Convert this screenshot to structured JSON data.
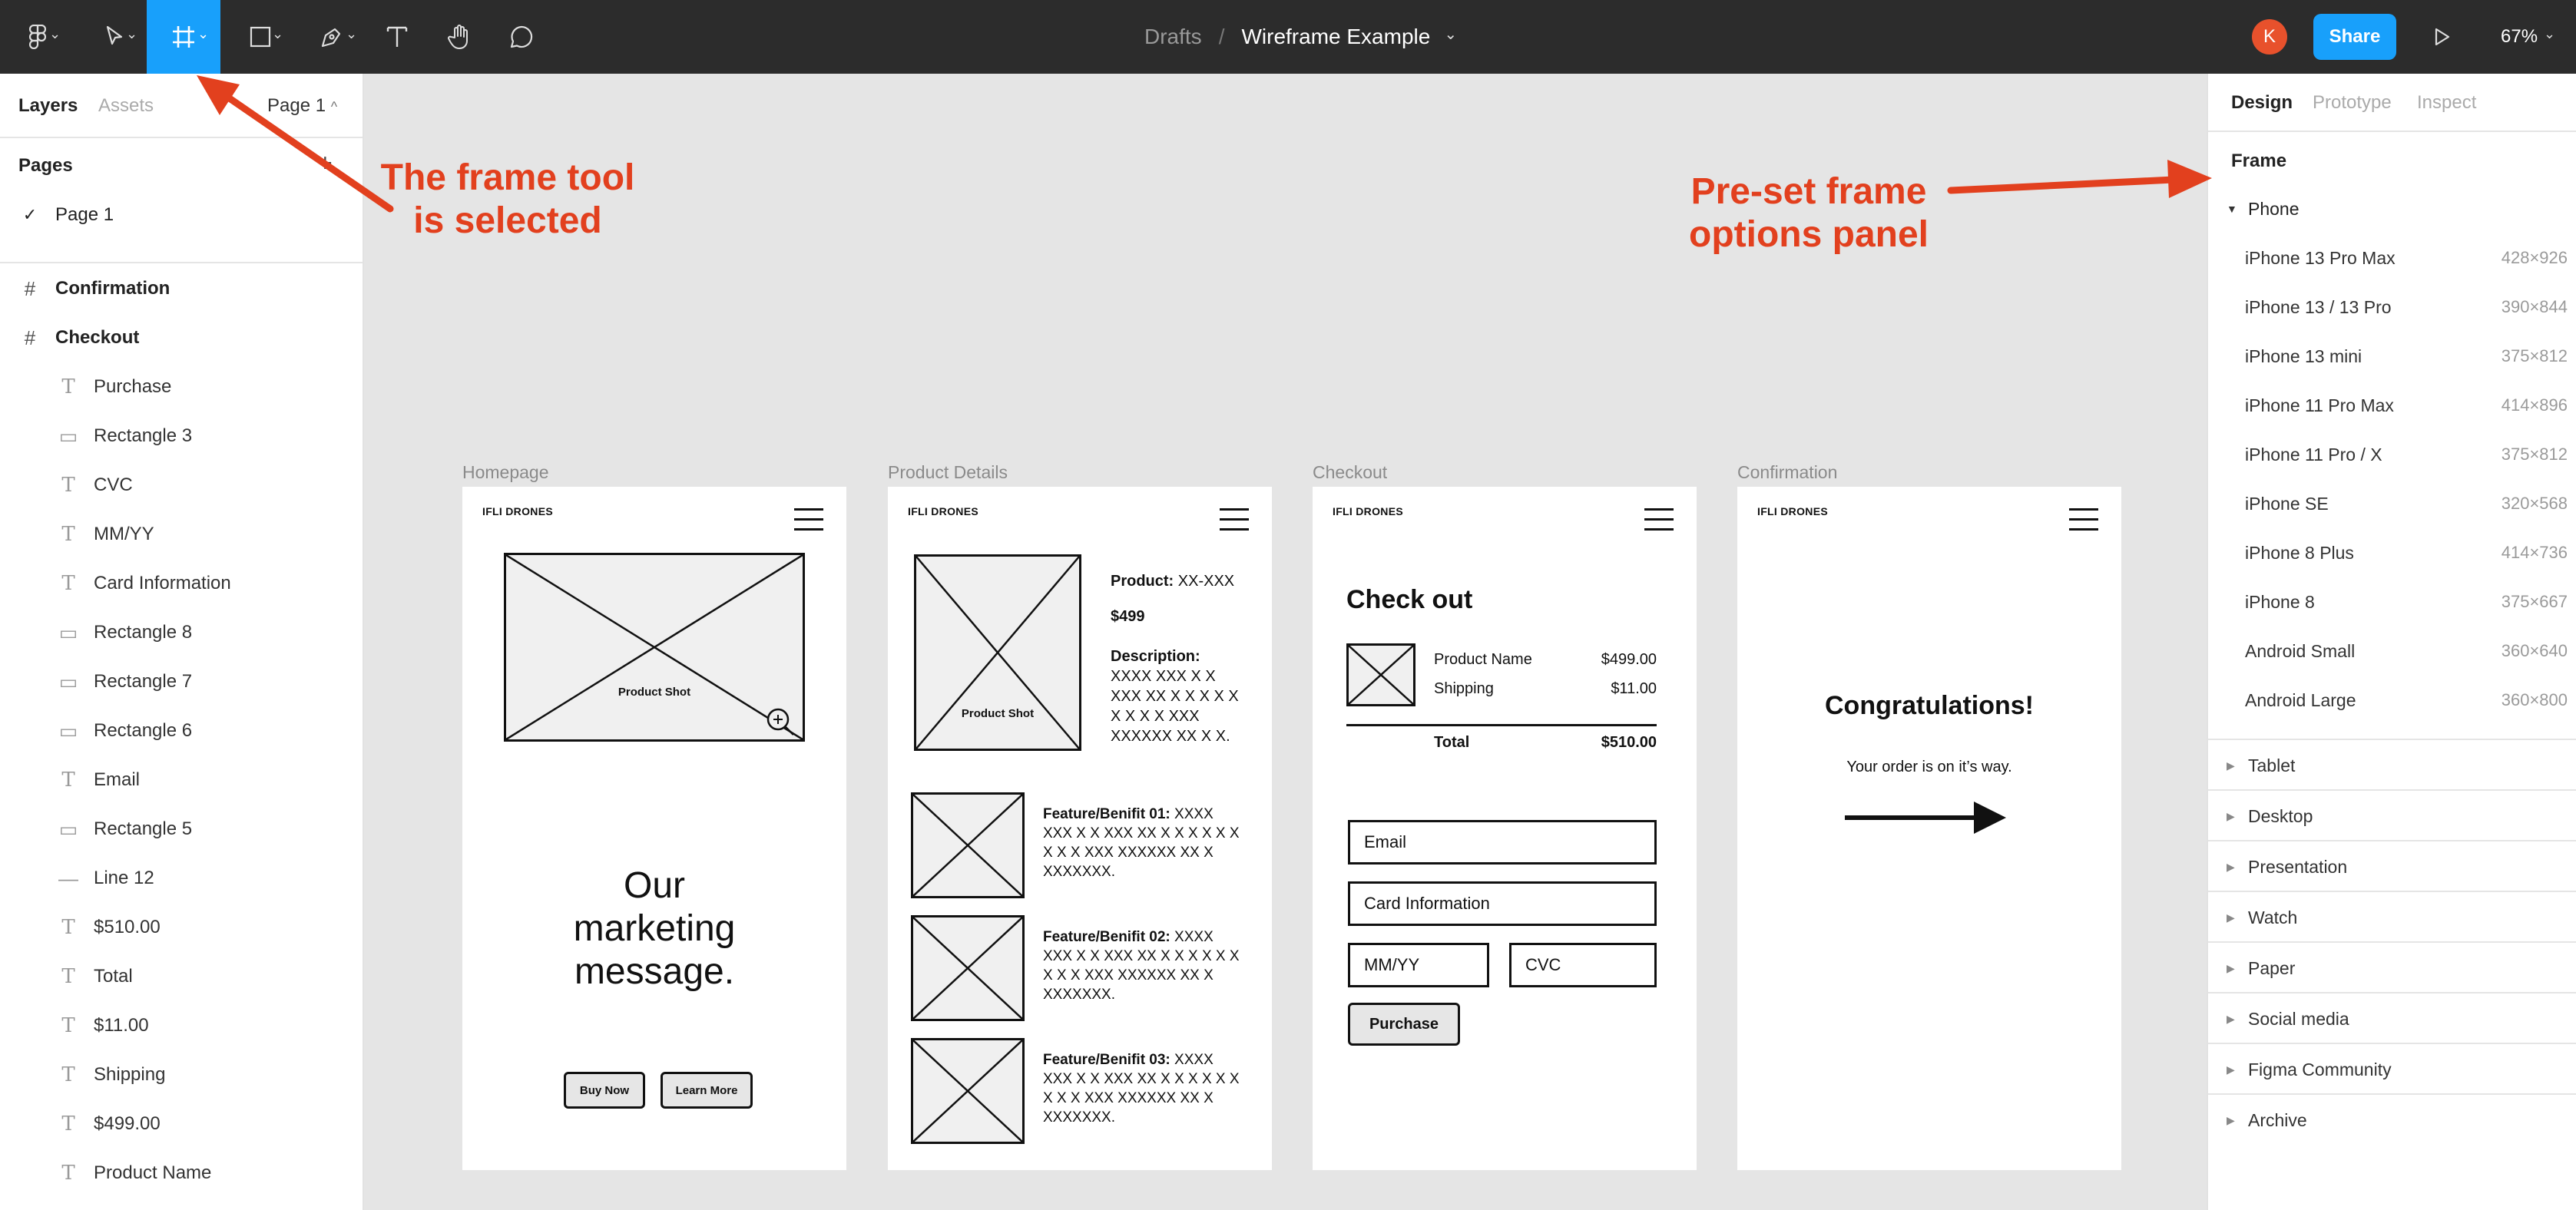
{
  "toolbar": {
    "breadcrumb_parent": "Drafts",
    "separator": "/",
    "file_name": "Wireframe Example",
    "avatar_initial": "K",
    "share_label": "Share",
    "zoom": "67%"
  },
  "left_panel": {
    "tabs": [
      "Layers",
      "Assets"
    ],
    "page_selector": "Page 1",
    "pages_heading": "Pages",
    "pages": [
      "Page 1"
    ],
    "frames": [
      "Confirmation",
      "Checkout"
    ],
    "layers": [
      {
        "name": "Purchase",
        "icon": "text-icon"
      },
      {
        "name": "Rectangle 3",
        "icon": "rectangle-icon"
      },
      {
        "name": "CVC",
        "icon": "text-icon"
      },
      {
        "name": "MM/YY",
        "icon": "text-icon"
      },
      {
        "name": "Card Information",
        "icon": "text-icon"
      },
      {
        "name": "Rectangle 8",
        "icon": "rectangle-icon"
      },
      {
        "name": "Rectangle 7",
        "icon": "rectangle-icon"
      },
      {
        "name": "Rectangle 6",
        "icon": "rectangle-icon"
      },
      {
        "name": "Email",
        "icon": "text-icon"
      },
      {
        "name": "Rectangle 5",
        "icon": "rectangle-icon"
      },
      {
        "name": "Line 12",
        "icon": "line-icon"
      },
      {
        "name": "$510.00",
        "icon": "text-icon"
      },
      {
        "name": "Total",
        "icon": "text-icon"
      },
      {
        "name": "$11.00",
        "icon": "text-icon"
      },
      {
        "name": "Shipping",
        "icon": "text-icon"
      },
      {
        "name": "$499.00",
        "icon": "text-icon"
      },
      {
        "name": "Product Name",
        "icon": "text-icon"
      }
    ]
  },
  "right_panel": {
    "tabs": [
      "Design",
      "Prototype",
      "Inspect"
    ],
    "section": "Frame",
    "open_category": "Phone",
    "presets": [
      {
        "name": "iPhone 13 Pro Max",
        "size": "428×926"
      },
      {
        "name": "iPhone 13 / 13 Pro",
        "size": "390×844"
      },
      {
        "name": "iPhone 13 mini",
        "size": "375×812"
      },
      {
        "name": "iPhone 11 Pro Max",
        "size": "414×896"
      },
      {
        "name": "iPhone 11 Pro / X",
        "size": "375×812"
      },
      {
        "name": "iPhone SE",
        "size": "320×568"
      },
      {
        "name": "iPhone 8 Plus",
        "size": "414×736"
      },
      {
        "name": "iPhone 8",
        "size": "375×667"
      },
      {
        "name": "Android Small",
        "size": "360×640"
      },
      {
        "name": "Android Large",
        "size": "360×800"
      }
    ],
    "categories": [
      "Tablet",
      "Desktop",
      "Presentation",
      "Watch",
      "Paper",
      "Social media",
      "Figma Community",
      "Archive"
    ]
  },
  "annotations": {
    "frame_tool": "The frame tool\nis selected",
    "preset_panel": "Pre-set frame\noptions panel"
  },
  "frames": {
    "homepage": {
      "label": "Homepage",
      "brand": "IFLI DRONES",
      "image_caption": "Product Shot",
      "marketing": "Our\nmarketing\nmessage.",
      "buy_button": "Buy Now",
      "learn_button": "Learn More"
    },
    "product": {
      "label": "Product Details",
      "brand": "IFLI DRONES",
      "image_caption": "Product Shot",
      "product_label": "Product:",
      "product_value": " XX-XXX",
      "price": "$499",
      "description_label": "Description:",
      "description_text": "XXXX XXX X X XXX XX X X X X X X X X X XXX XXXXXX XX X X.",
      "features": [
        {
          "label": "Feature/Benifit 01:",
          "text": " XXXX XXX X X XXX XX X X X X X X X X X XXX XXXXXX XX X XXXXXXX."
        },
        {
          "label": "Feature/Benifit 02:",
          "text": " XXXX XXX X X XXX XX X X X X X X X X X XXX XXXXXX XX X XXXXXXX."
        },
        {
          "label": "Feature/Benifit 03:",
          "text": " XXXX XXX X X XXX XX X X X X X X X X X XXX XXXXXX XX X XXXXXXX."
        }
      ]
    },
    "checkout": {
      "label": "Checkout",
      "brand": "IFLI DRONES",
      "title": "Check out",
      "product_name": "Product Name",
      "product_price": "$499.00",
      "shipping": "Shipping",
      "shipping_price": "$11.00",
      "total_label": "Total",
      "total_price": "$510.00",
      "email": "Email",
      "card": "Card Information",
      "mmyy": "MM/YY",
      "cvc": "CVC",
      "purchase": "Purchase"
    },
    "confirmation": {
      "label": "Confirmation",
      "brand": "IFLI DRONES",
      "title": "Congratulations!",
      "message": "Your order is on it’s way."
    }
  },
  "colors": {
    "toolbar_bg": "#2c2c2c",
    "accent": "#18a0fb",
    "avatar": "#e8512c",
    "annotation": "#e2401e",
    "canvas": "#e5e5e5"
  }
}
